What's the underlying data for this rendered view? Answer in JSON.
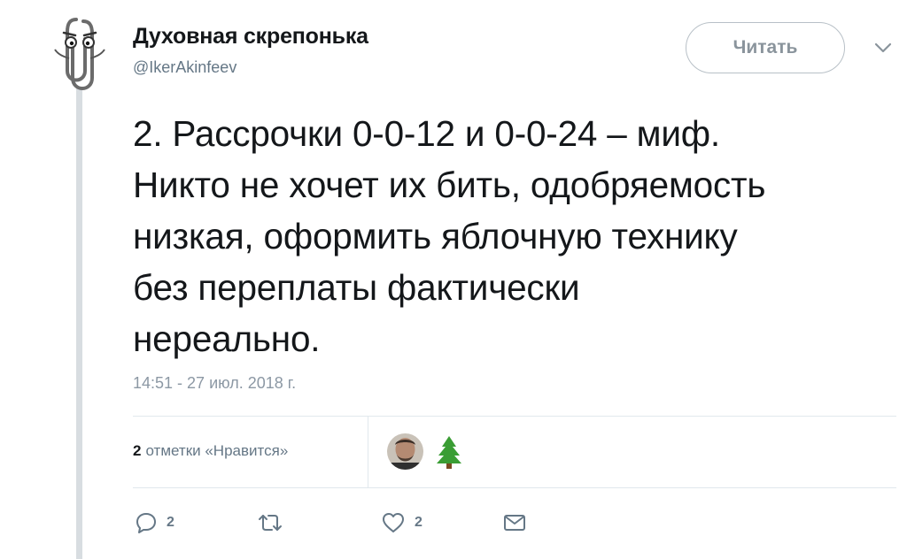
{
  "author": {
    "display_name": "Духовная скрепонька",
    "username": "@IkerAkinfeev",
    "avatar_icon": "paperclip-mascot-icon"
  },
  "header": {
    "follow_label": "Читать",
    "menu_icon": "chevron-down-icon"
  },
  "tweet": {
    "text": "2. Рассрочки 0-0-12 и 0-0-24 – миф.\nНикто не хочет их бить, одобряемость\nнизкая, оформить яблочную технику\nбез переплаты фактически\nнереально.",
    "timestamp": "14:51 - 27 июл. 2018 г."
  },
  "stats": {
    "likes_count": "2",
    "likes_label": "отметки «Нравится»",
    "likers": [
      {
        "icon": "user-photo-avatar"
      },
      {
        "icon": "christmas-tree-icon"
      }
    ]
  },
  "actions": {
    "reply_count": "2",
    "retweet_count": "",
    "like_count": "2"
  },
  "colors": {
    "text": "#14171a",
    "secondary": "#657786",
    "border": "#e1e8ed",
    "thread_line": "#d8dde1"
  }
}
